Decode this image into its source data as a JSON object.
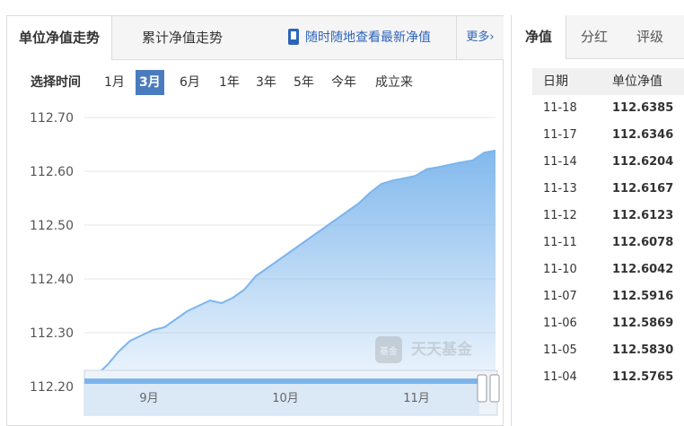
{
  "left_tabs": {
    "unit_nav": "单位净值走势",
    "acc_nav": "累计净值走势",
    "mobile_link": "随时随地查看最新净值",
    "more": "更多"
  },
  "period": {
    "label": "选择时间",
    "options": [
      "1月",
      "3月",
      "6月",
      "1年",
      "3年",
      "5年",
      "今年",
      "成立来"
    ],
    "selected": "3月"
  },
  "chart_data": {
    "type": "area",
    "yticks": [
      "112.70",
      "112.60",
      "112.50",
      "112.40",
      "112.30",
      "112.20"
    ],
    "ylim": [
      112.2,
      112.7
    ],
    "xticks": [
      "9月",
      "10月",
      "11月"
    ],
    "series": [
      {
        "values": [
          112.205,
          112.22,
          112.24,
          112.265,
          112.285,
          112.295,
          112.305,
          112.31,
          112.325,
          112.34,
          112.35,
          112.36,
          112.355,
          112.365,
          112.38,
          112.405,
          112.42,
          112.435,
          112.45,
          112.465,
          112.48,
          112.495,
          112.51,
          112.525,
          112.54,
          112.56,
          112.5765,
          112.583,
          112.5869,
          112.5916,
          112.6042,
          112.6078,
          112.6123,
          112.6167,
          112.6204,
          112.6346,
          112.6385
        ]
      }
    ],
    "color": "#7cb5ec",
    "watermark": "天天基金"
  },
  "right_tabs": {
    "nav": "净值",
    "dividend": "分红",
    "rating": "评级"
  },
  "table": {
    "headers": [
      "日期",
      "单位净值"
    ],
    "rows": [
      [
        "11-18",
        "112.6385"
      ],
      [
        "11-17",
        "112.6346"
      ],
      [
        "11-14",
        "112.6204"
      ],
      [
        "11-13",
        "112.6167"
      ],
      [
        "11-12",
        "112.6123"
      ],
      [
        "11-11",
        "112.6078"
      ],
      [
        "11-10",
        "112.6042"
      ],
      [
        "11-07",
        "112.5916"
      ],
      [
        "11-06",
        "112.5869"
      ],
      [
        "11-05",
        "112.5830"
      ],
      [
        "11-04",
        "112.5765"
      ]
    ]
  }
}
